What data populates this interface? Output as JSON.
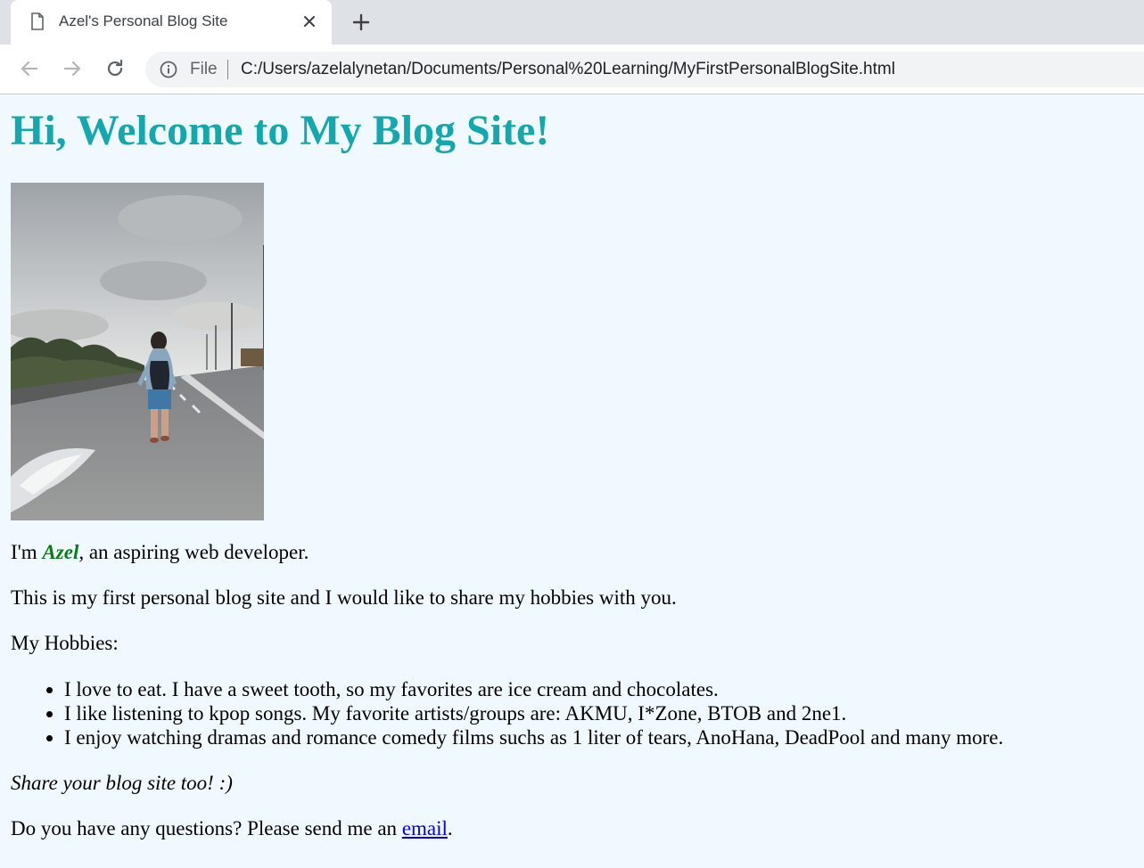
{
  "browser": {
    "tab_title": "Azel's Personal Blog Site",
    "file_label": "File",
    "url": "C:/Users/azelalynetan/Documents/Personal%20Learning/MyFirstPersonalBlogSite.html",
    "icons": [
      "document-icon",
      "close-icon",
      "plus-icon",
      "back-arrow-icon",
      "forward-arrow-icon",
      "reload-icon",
      "info-icon"
    ]
  },
  "page": {
    "heading": "Hi, Welcome to My Blog Site!",
    "intro_prefix": "I'm ",
    "name": "Azel",
    "intro_suffix": ", an aspiring web developer.",
    "paragraph": "This is my first personal blog site and I would like to share my hobbies with you.",
    "hobbies_label": "My Hobbies:",
    "hobbies": [
      "I love to eat. I have a sweet tooth, so my favorites are ice cream and chocolates.",
      "I like listening to kpop songs. My favorite artists/groups are: AKMU, I*Zone, BTOB and 2ne1.",
      "I enjoy watching dramas and romance comedy films suchs as 1 liter of tears, AnoHana, DeadPool and many more."
    ],
    "share_text": "Share your blog site too! :)",
    "contact_prefix": "Do you have any questions? Please send me an ",
    "contact_link": "email",
    "contact_suffix": "."
  },
  "colors": {
    "heading": "#13a8ad",
    "name": "#0a7e14",
    "link": "#0000ee",
    "page_background": "#f0f9ff",
    "tabstrip": "#dee1e6",
    "omnibox": "#f1f3f4"
  }
}
